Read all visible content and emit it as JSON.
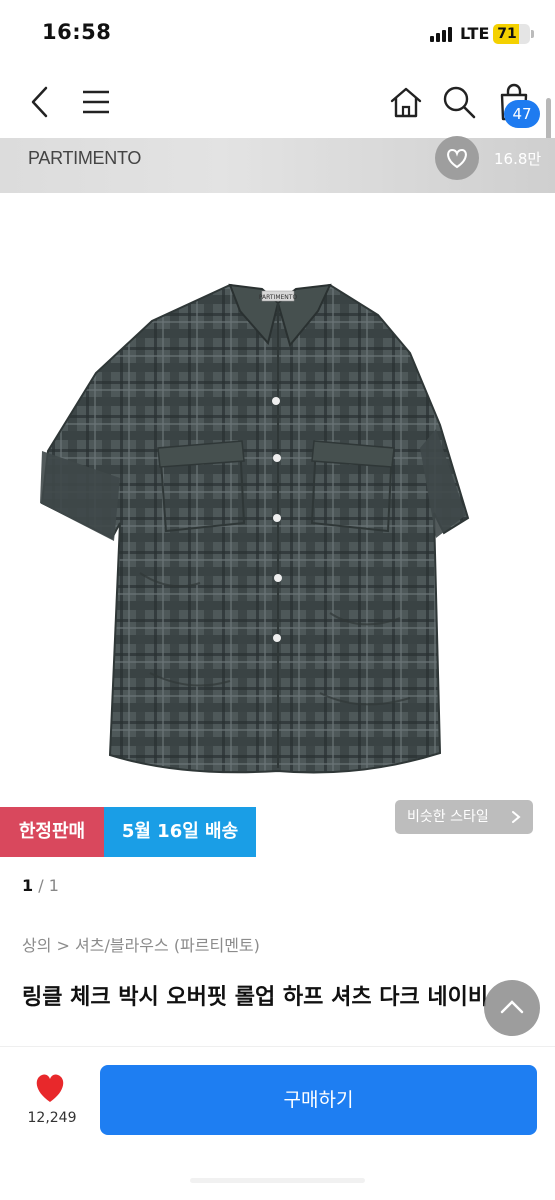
{
  "status_bar": {
    "time": "16:58",
    "network": "LTE",
    "battery_percent": "71",
    "battery_level": 0.71,
    "battery_color": "#f4d100"
  },
  "nav": {
    "back_icon": "chevron-left-icon",
    "menu_icon": "hamburger-icon",
    "home_icon": "home-icon",
    "search_icon": "search-icon",
    "cart_icon": "shopping-bag-icon",
    "cart_count": "47",
    "accent_color": "#1e7bf0"
  },
  "brand": {
    "name": "PARTIMENTO",
    "likes": "16.8만",
    "like_icon": "heart-outline-icon"
  },
  "product": {
    "image_subject": "plaid short-sleeve shirt",
    "image_label": "PARTIMENTO",
    "tags": {
      "limited": "한정판매",
      "delivery": "5월 16일 배송",
      "limited_color": "#d9485d",
      "delivery_color": "#1a9ee6"
    },
    "similar_style": "비슷한 스타일",
    "pager": {
      "current": "1",
      "separator": "/",
      "total": "1"
    },
    "breadcrumb": "상의 > 셔츠/블라우스 (파르티멘토)",
    "title": "링클 체크 박시 오버핏 롤업 하프 셔츠 다크 네이비"
  },
  "bottom_bar": {
    "wish_count": "12,249",
    "wish_icon": "heart-filled-icon",
    "wish_color": "#e8282b",
    "buy_label": "구매하기",
    "buy_color": "#1e7ef2"
  }
}
